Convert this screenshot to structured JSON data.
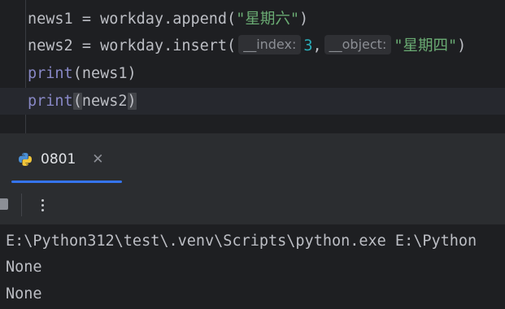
{
  "editor": {
    "line1": {
      "prefix": "news1 = workday.append(",
      "arg": "\"星期六\"",
      "suffix": ")"
    },
    "line2": {
      "prefix": "news2 = workday.insert(",
      "hint1": "__index:",
      "num": "3",
      "comma": ",",
      "hint2": "__object:",
      "arg": "\"星期四\"",
      "suffix": ")"
    },
    "line3": {
      "func": "print",
      "args": "(news1)"
    },
    "line4": {
      "func": "print",
      "open": "(",
      "args": "news2",
      "close": ")"
    }
  },
  "run_panel": {
    "tab_label": "0801",
    "tab_icon": "python-icon",
    "close_icon": "close-icon",
    "toolbar": {
      "stop_icon": "stop-icon",
      "more_icon": "more-vertical-icon"
    },
    "output": [
      "E:\\Python312\\test\\.venv\\Scripts\\python.exe E:\\Python",
      "None",
      "None"
    ]
  },
  "colors": {
    "editor_bg": "#1e1f22",
    "panel_bg": "#2b2d30",
    "string": "#6aab73",
    "number": "#2aacb8",
    "builtin": "#8888c6",
    "accent": "#3574f0"
  }
}
